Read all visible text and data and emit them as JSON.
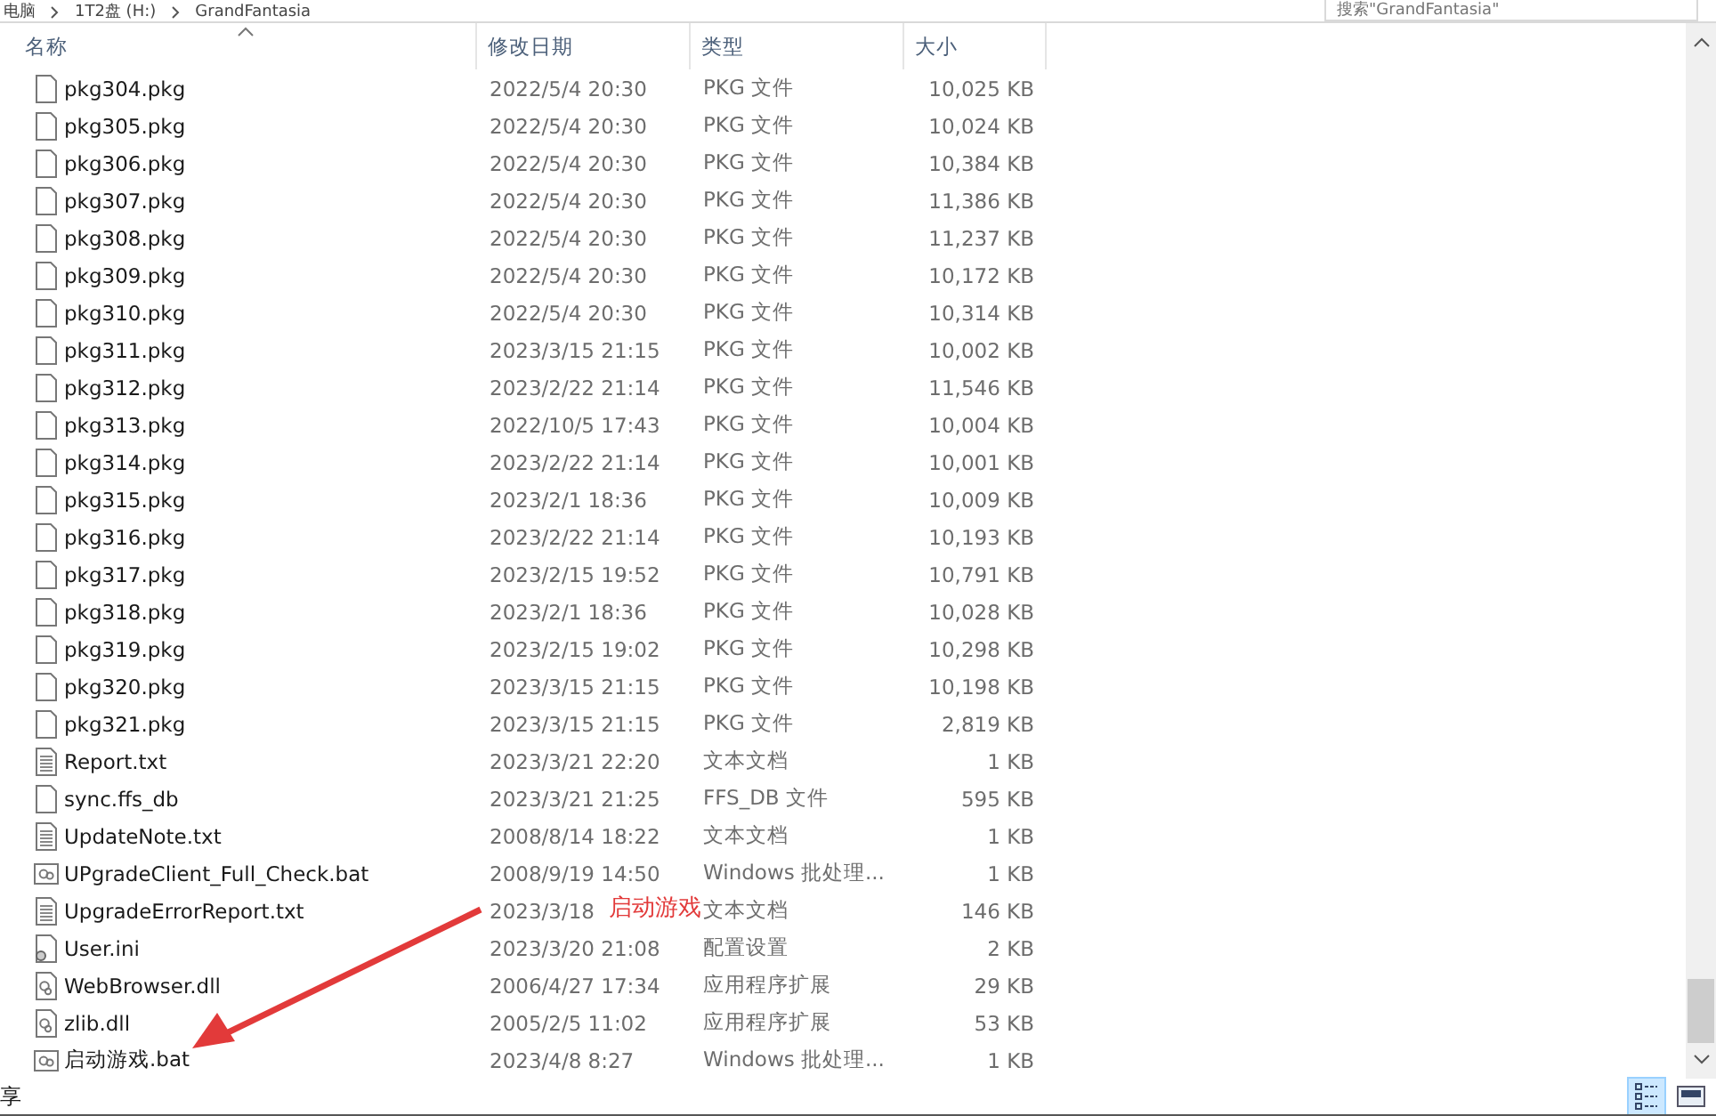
{
  "breadcrumb": [
    "电脑",
    "1T2盘 (H:)",
    "GrandFantasia"
  ],
  "search": {
    "placeholder": "搜索\"GrandFantasia\""
  },
  "columns": [
    "名称",
    "修改日期",
    "类型",
    "大小"
  ],
  "rows": [
    {
      "kind": "blank",
      "name": "pkg304.pkg",
      "date": "2022/5/4 20:30",
      "type": "PKG 文件",
      "size": "10,025 KB"
    },
    {
      "kind": "blank",
      "name": "pkg305.pkg",
      "date": "2022/5/4 20:30",
      "type": "PKG 文件",
      "size": "10,024 KB"
    },
    {
      "kind": "blank",
      "name": "pkg306.pkg",
      "date": "2022/5/4 20:30",
      "type": "PKG 文件",
      "size": "10,384 KB"
    },
    {
      "kind": "blank",
      "name": "pkg307.pkg",
      "date": "2022/5/4 20:30",
      "type": "PKG 文件",
      "size": "11,386 KB"
    },
    {
      "kind": "blank",
      "name": "pkg308.pkg",
      "date": "2022/5/4 20:30",
      "type": "PKG 文件",
      "size": "11,237 KB"
    },
    {
      "kind": "blank",
      "name": "pkg309.pkg",
      "date": "2022/5/4 20:30",
      "type": "PKG 文件",
      "size": "10,172 KB"
    },
    {
      "kind": "blank",
      "name": "pkg310.pkg",
      "date": "2022/5/4 20:30",
      "type": "PKG 文件",
      "size": "10,314 KB"
    },
    {
      "kind": "blank",
      "name": "pkg311.pkg",
      "date": "2023/3/15 21:15",
      "type": "PKG 文件",
      "size": "10,002 KB"
    },
    {
      "kind": "blank",
      "name": "pkg312.pkg",
      "date": "2023/2/22 21:14",
      "type": "PKG 文件",
      "size": "11,546 KB"
    },
    {
      "kind": "blank",
      "name": "pkg313.pkg",
      "date": "2022/10/5 17:43",
      "type": "PKG 文件",
      "size": "10,004 KB"
    },
    {
      "kind": "blank",
      "name": "pkg314.pkg",
      "date": "2023/2/22 21:14",
      "type": "PKG 文件",
      "size": "10,001 KB"
    },
    {
      "kind": "blank",
      "name": "pkg315.pkg",
      "date": "2023/2/1 18:36",
      "type": "PKG 文件",
      "size": "10,009 KB"
    },
    {
      "kind": "blank",
      "name": "pkg316.pkg",
      "date": "2023/2/22 21:14",
      "type": "PKG 文件",
      "size": "10,193 KB"
    },
    {
      "kind": "blank",
      "name": "pkg317.pkg",
      "date": "2023/2/15 19:52",
      "type": "PKG 文件",
      "size": "10,791 KB"
    },
    {
      "kind": "blank",
      "name": "pkg318.pkg",
      "date": "2023/2/1 18:36",
      "type": "PKG 文件",
      "size": "10,028 KB"
    },
    {
      "kind": "blank",
      "name": "pkg319.pkg",
      "date": "2023/2/15 19:02",
      "type": "PKG 文件",
      "size": "10,298 KB"
    },
    {
      "kind": "blank",
      "name": "pkg320.pkg",
      "date": "2023/3/15 21:15",
      "type": "PKG 文件",
      "size": "10,198 KB"
    },
    {
      "kind": "blank",
      "name": "pkg321.pkg",
      "date": "2023/3/15 21:15",
      "type": "PKG 文件",
      "size": "2,819 KB"
    },
    {
      "kind": "text",
      "name": "Report.txt",
      "date": "2023/3/21 22:20",
      "type": "文本文档",
      "size": "1 KB"
    },
    {
      "kind": "blank",
      "name": "sync.ffs_db",
      "date": "2023/3/21 21:25",
      "type": "FFS_DB 文件",
      "size": "595 KB"
    },
    {
      "kind": "text",
      "name": "UpdateNote.txt",
      "date": "2008/8/14 18:22",
      "type": "文本文档",
      "size": "1 KB"
    },
    {
      "kind": "bat",
      "name": "UPgradeClient_Full_Check.bat",
      "date": "2008/9/19 14:50",
      "type": "Windows 批处理...",
      "size": "1 KB"
    },
    {
      "kind": "text",
      "name": "UpgradeErrorReport.txt",
      "date": "2023/3/18",
      "type": "文本文档",
      "size": "146 KB"
    },
    {
      "kind": "ini",
      "name": "User.ini",
      "date": "2023/3/20 21:08",
      "type": "配置设置",
      "size": "2 KB"
    },
    {
      "kind": "dll",
      "name": "WebBrowser.dll",
      "date": "2006/4/27 17:34",
      "type": "应用程序扩展",
      "size": "29 KB"
    },
    {
      "kind": "dll",
      "name": "zlib.dll",
      "date": "2005/2/5 11:02",
      "type": "应用程序扩展",
      "size": "53 KB"
    },
    {
      "kind": "bat",
      "name": "启动游戏.bat",
      "date": "2023/4/8 8:27",
      "type": "Windows 批处理...",
      "size": "1 KB"
    }
  ],
  "annotation": {
    "text": "启动游戏"
  },
  "status_bar": {
    "text": "享"
  }
}
